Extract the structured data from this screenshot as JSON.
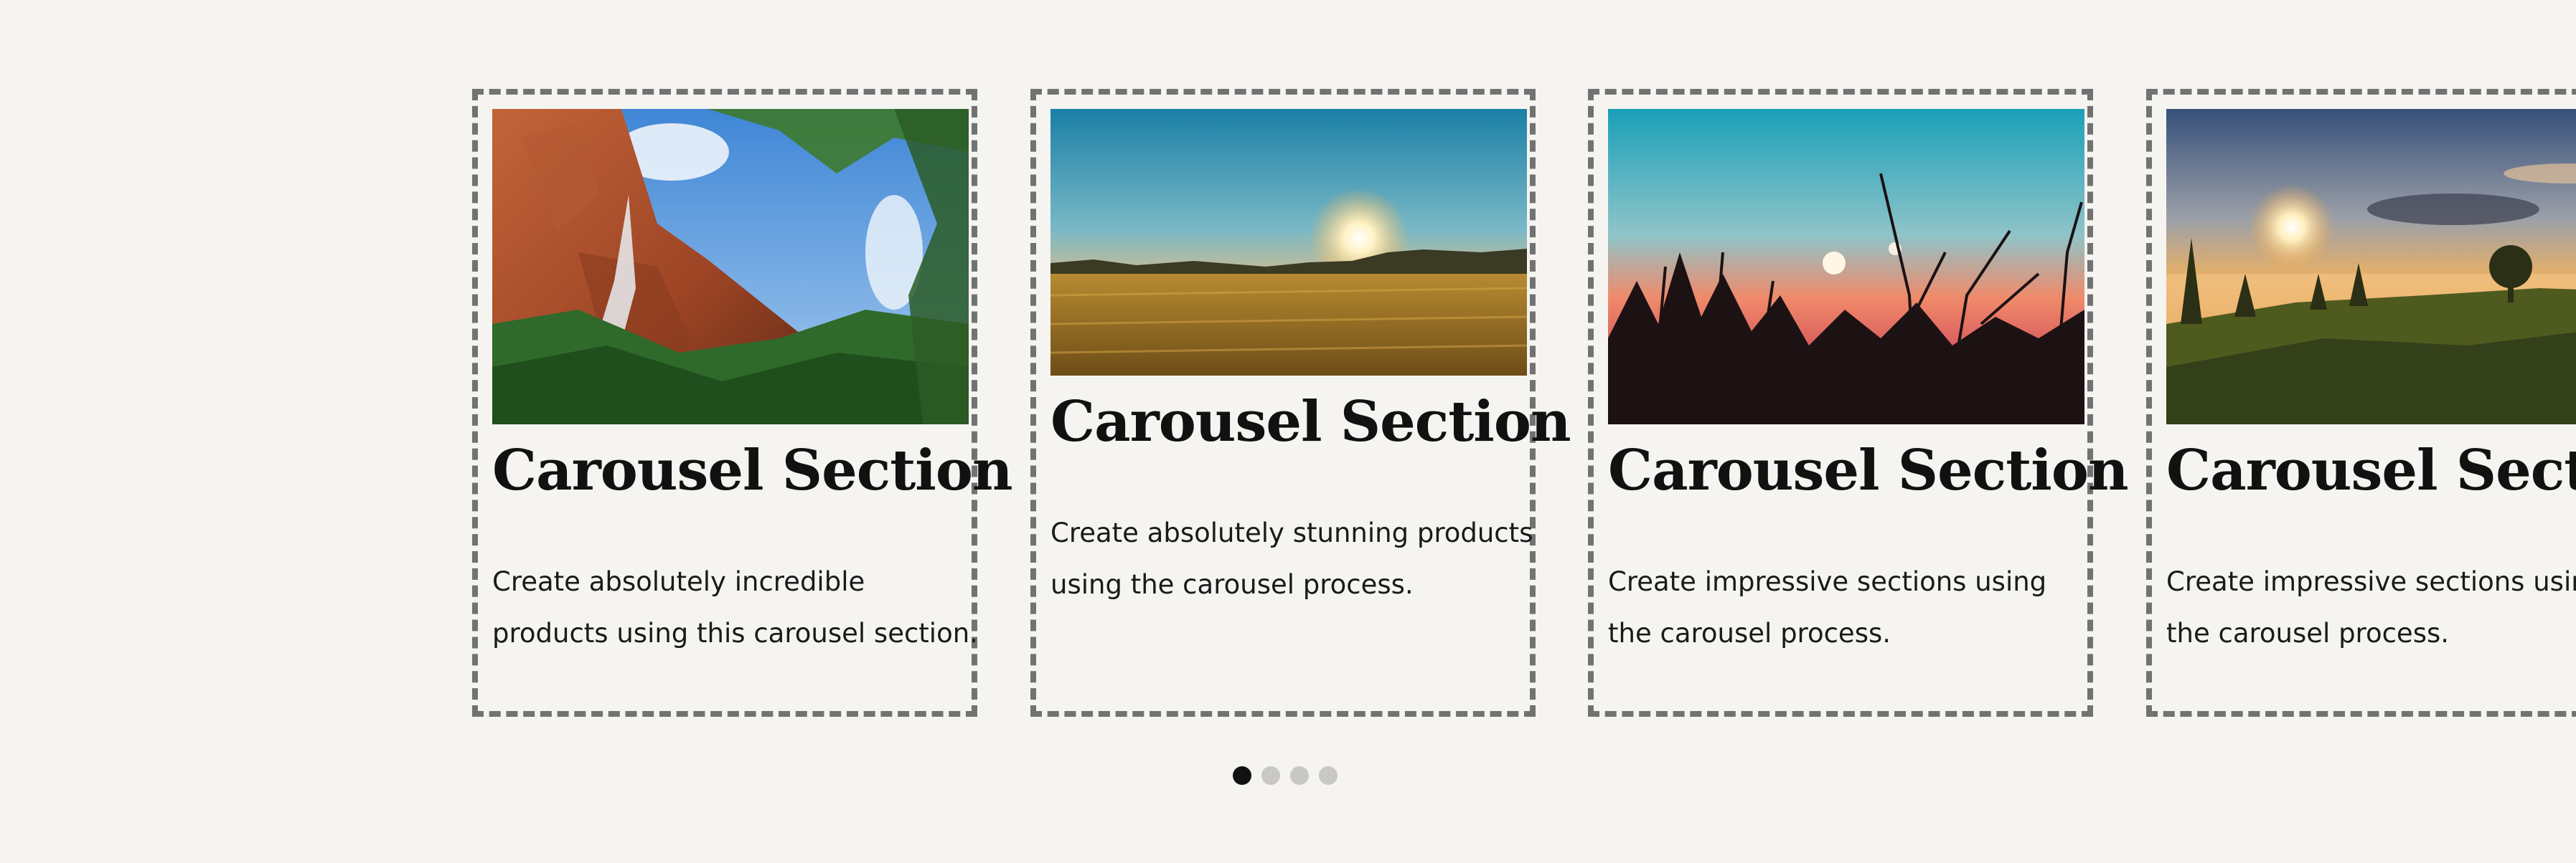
{
  "carousel": {
    "slides": [
      {
        "image": "canyon-waterfall-photo",
        "title": "Carousel Section",
        "text": "Create absolutely incredible products using this carousel section."
      },
      {
        "image": "golden-field-sunrise-photo",
        "title": "Carousel Section",
        "text": "Create absolutely stunning products using the carousel process."
      },
      {
        "image": "silhouette-plants-sunset-photo",
        "title": "Carousel Section",
        "text": "Create impressive sections using the carousel process."
      },
      {
        "image": "misty-meadow-sunrise-photo",
        "title": "Carousel Section",
        "text": "Create impressive sections using the carousel process."
      }
    ],
    "pagination": {
      "count": 4,
      "active_index": 0
    }
  },
  "colors": {
    "background": "#f5f4f1",
    "border": "#727272",
    "dot_active": "#111111",
    "dot_inactive": "#c9c8c6"
  }
}
